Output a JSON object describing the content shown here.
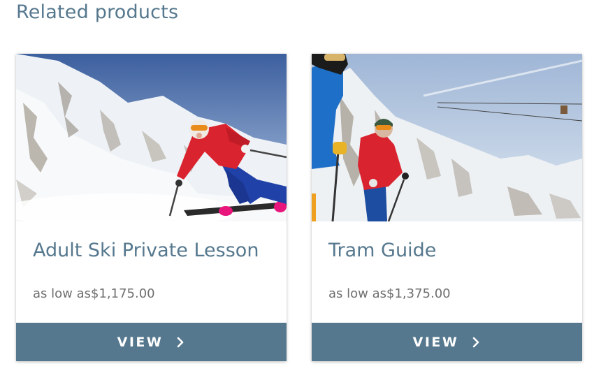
{
  "section": {
    "title": "Related products"
  },
  "products": [
    {
      "title": "Adult Ski Private Lesson",
      "price_prefix": "as low as",
      "price": "$1,175.00",
      "button_label": "VIEW",
      "image": "skier-carving-on-slope"
    },
    {
      "title": "Tram Guide",
      "price_prefix": "as low as",
      "price": "$1,375.00",
      "button_label": "VIEW",
      "image": "ski-guide-under-tram"
    }
  ],
  "colors": {
    "accent": "#56788e",
    "price_text": "#6f6f6f",
    "button_text": "#ffffff"
  }
}
